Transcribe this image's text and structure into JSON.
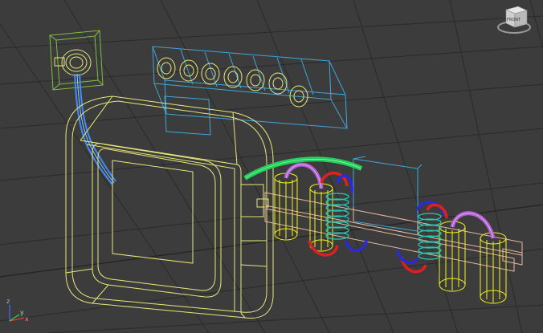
{
  "viewcube": {
    "face_label": "FRONT"
  },
  "axis_tripod": {
    "z": "z",
    "x": "x",
    "y": "y"
  },
  "colors": {
    "background": "#3c3c3c",
    "grid": "#2a2a2a",
    "green_wire": "#7fbf3f",
    "blue_tube": "#3f8cff",
    "cyan_wire": "#3fa7d6",
    "yellow_wire": "#e8e87a",
    "bright_yellow": "#f2f21a",
    "green_tube": "#22d05a",
    "teal_coil": "#2ac6b0",
    "red_arc": "#e02020",
    "dark_blue_arc": "#2a2ad8",
    "purple_coil": "#b060d0",
    "peach_wire": "#e8b8a0"
  }
}
